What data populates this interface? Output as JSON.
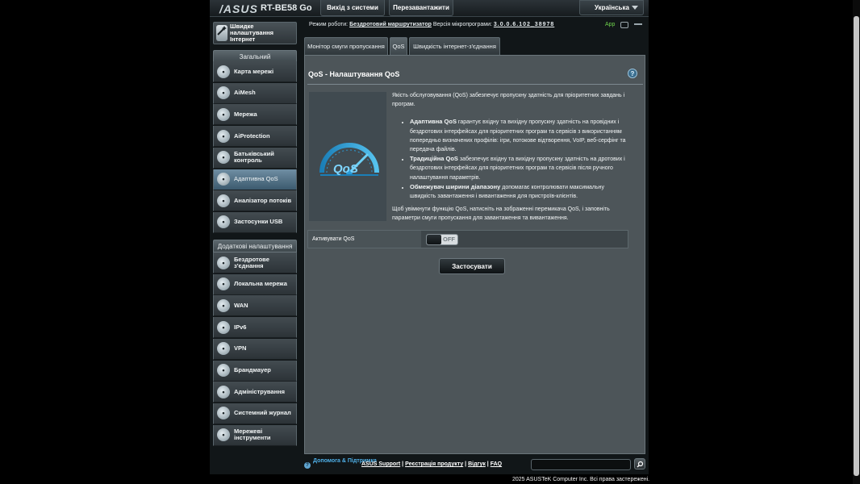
{
  "header": {
    "brand": "/ASUS",
    "model": "RT-BE58 Go",
    "logout_label": "Вихід з системи",
    "reboot_label": "Перезавантажити",
    "language": "Українська"
  },
  "status": {
    "mode_label": "Режим роботи:",
    "mode_value": "Бездротовий маршрутизатор",
    "firmware_label": "Версія мікропрограми:",
    "firmware_value": "3.0.0.6.102_38978",
    "app_label": "App"
  },
  "sidebar": {
    "quick_setup": "Швидке налаштування Інтернет",
    "general_header": "Загальний",
    "general_items": [
      {
        "label": "Карта мережі",
        "icon": "network-map-icon"
      },
      {
        "label": "AiMesh",
        "icon": "aimesh-icon"
      },
      {
        "label": "Мережа",
        "icon": "network-icon"
      },
      {
        "label": "AiProtection",
        "icon": "aiprotection-icon"
      },
      {
        "label": "Батьківський контроль",
        "icon": "parental-control-icon"
      },
      {
        "label": "Адаптивна QoS",
        "icon": "qos-icon"
      },
      {
        "label": "Аналізатор потоків",
        "icon": "traffic-analyzer-icon"
      },
      {
        "label": "Застосунки USB",
        "icon": "usb-icon"
      }
    ],
    "advanced_header": "Додаткові налаштування",
    "advanced_items": [
      {
        "label": "Бездротове з'єднання",
        "icon": "wireless-icon"
      },
      {
        "label": "Локальна мережа",
        "icon": "lan-icon"
      },
      {
        "label": "WAN",
        "icon": "wan-icon"
      },
      {
        "label": "IPv6",
        "icon": "ipv6-icon"
      },
      {
        "label": "VPN",
        "icon": "vpn-icon"
      },
      {
        "label": "Брандмауер",
        "icon": "firewall-icon"
      },
      {
        "label": "Адміністрування",
        "icon": "administration-icon"
      },
      {
        "label": "Системний журнал",
        "icon": "system-log-icon"
      },
      {
        "label": "Мережеві інструменти",
        "icon": "network-tools-icon"
      }
    ]
  },
  "tabs": [
    {
      "label": "Монітор смуги пропускання"
    },
    {
      "label": "QoS"
    },
    {
      "label": "Швидкість інтернет-з'єднання"
    }
  ],
  "panel": {
    "title": "QoS - Налаштування QoS",
    "intro": "Якість обслуговування (QoS) забезпечує пропускну здатність для пріоритетних завдань і програм.",
    "bullets": [
      {
        "bold": "Адаптивна QoS",
        "text": " гарантує вхідну та вихідну пропускну здатність на провідних і бездротових інтерфейсах для пріоритетних програм та сервісів з використанням попередньо визначених профілів: ігри, потокове відтворення, VoIP, веб-серфінг та передача файлів."
      },
      {
        "bold": "Традиційна QoS",
        "text": " забезпечує вхідну та вихідну пропускну здатність на дротових і бездротових інтерфейсах для пріоритетних програм та сервісів після ручного налаштування параметрів."
      },
      {
        "bold": "Обмежувач ширини діапазону",
        "text": " допомагає контролювати максимальну швидкість завантаження і вивантаження для пристроїв-клієнтів."
      }
    ],
    "outro": "Щоб увімкнути функцію QoS, натисніть на зображенні перемикача QoS, і заповніть параметри смуги пропускання для завантаження та вивантаження.",
    "enable_label": "Активувати QoS",
    "toggle_state": "OFF",
    "apply_label": "Застосувати",
    "graphic_text": "QoS"
  },
  "footer": {
    "help": "Допомога & Підтримка",
    "links": [
      "ASUS Support",
      "Реєстрація продукту",
      "Відгук",
      "FAQ"
    ],
    "copyright": "2025 ASUSTeK Computer Inc. Всі права застережені."
  }
}
